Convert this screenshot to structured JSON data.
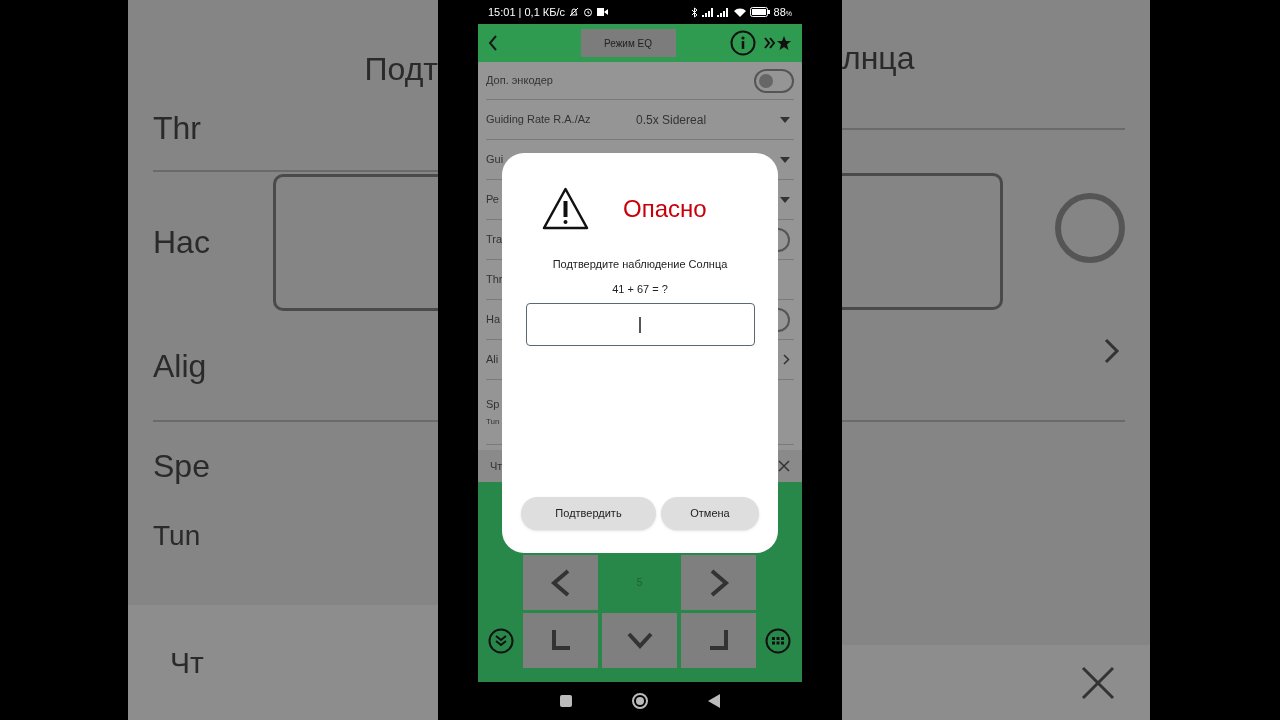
{
  "backdrop": {
    "left": {
      "heading": "Подт",
      "items": [
        {
          "label": "Thr"
        },
        {
          "label": "Нас"
        },
        {
          "label": "Alig"
        },
        {
          "label": "Spe"
        }
      ],
      "subtitle": "Tun",
      "footer": "Чт"
    },
    "right": {
      "heading": "лнца"
    }
  },
  "status_bar": {
    "text": "15:01 | 0,1 КБ/с",
    "battery": "88",
    "battery_unit": "%"
  },
  "header": {
    "title": "Режим EQ"
  },
  "settings": [
    {
      "kind": "toggle",
      "label": "Доп. энкодер",
      "on": false
    },
    {
      "kind": "dropdown",
      "label": "Guiding Rate R.A./Az",
      "value": "0.5x Sidereal"
    },
    {
      "kind": "dropdown",
      "label": "Gui"
    },
    {
      "kind": "dropdown",
      "label": "Ре"
    },
    {
      "kind": "switch",
      "label": "Tra"
    },
    {
      "kind": "text",
      "label": "Thr"
    },
    {
      "kind": "switch",
      "label": "На"
    },
    {
      "kind": "link",
      "label": "Ali"
    },
    {
      "kind": "text",
      "label": "Sp",
      "sublabel": "Tun"
    }
  ],
  "notice": {
    "label": "Чт"
  },
  "dialog": {
    "title": "Опасно",
    "message": "Подтвердите наблюдение Солнца",
    "question": "41 + 67 = ?",
    "buttons": [
      "Подтвердить",
      "Отмена"
    ]
  },
  "pad": {
    "center": "5"
  }
}
